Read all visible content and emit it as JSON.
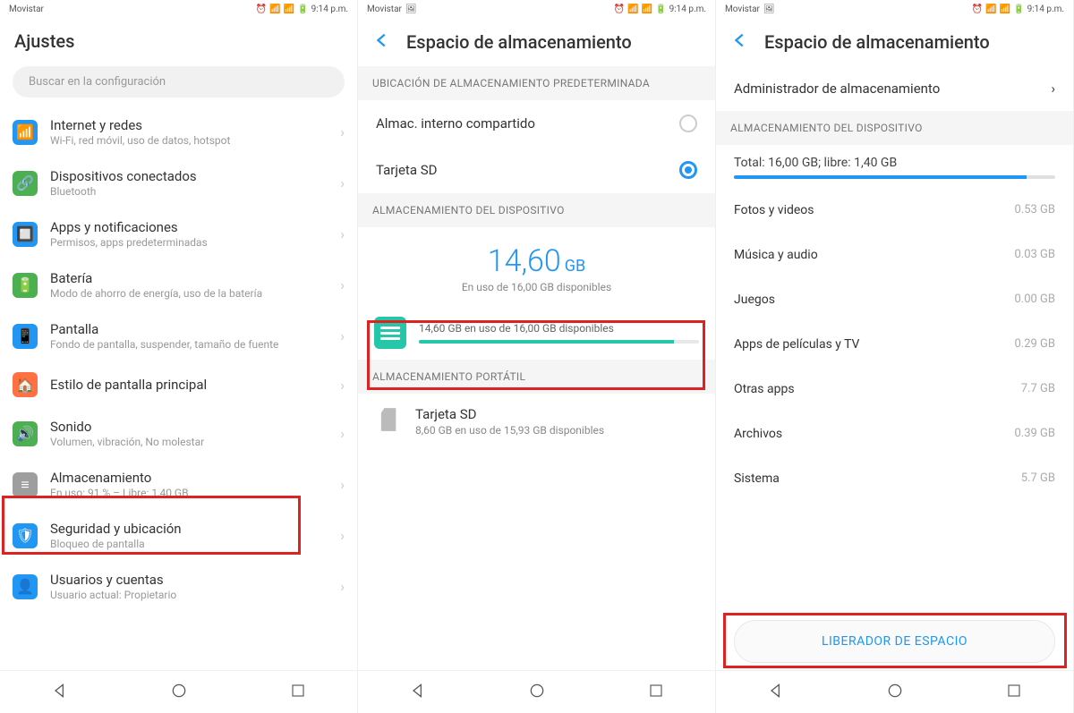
{
  "status": {
    "carrier": "Movistar",
    "time": "9:14 p.m."
  },
  "screen1": {
    "title": "Ajustes",
    "search_placeholder": "Buscar en la configuración",
    "items": [
      {
        "label": "Internet y redes",
        "sub": "Wi-Fi, red móvil, uso de datos, hotspot",
        "color": "#2196F3"
      },
      {
        "label": "Dispositivos conectados",
        "sub": "Bluetooth",
        "color": "#4CAF50"
      },
      {
        "label": "Apps y notificaciones",
        "sub": "Permisos, apps predeterminadas",
        "color": "#2196F3"
      },
      {
        "label": "Batería",
        "sub": "Modo de ahorro de energía, uso de la batería",
        "color": "#4CAF50"
      },
      {
        "label": "Pantalla",
        "sub": "Fondo de pantalla, suspender, tamaño de fuente",
        "color": "#2196F3"
      },
      {
        "label": "Estilo de pantalla principal",
        "sub": "",
        "color": "#FF7043"
      },
      {
        "label": "Sonido",
        "sub": "Volumen, vibración, No molestar",
        "color": "#4CAF50"
      },
      {
        "label": "Almacenamiento",
        "sub": "En uso: 91 % – Libre: 1,40 GB",
        "color": "#9E9E9E"
      },
      {
        "label": "Seguridad y ubicación",
        "sub": "Bloqueo de pantalla",
        "color": "#2196F3"
      },
      {
        "label": "Usuarios y cuentas",
        "sub": "Usuario actual: Propietario",
        "color": "#2196F3"
      }
    ]
  },
  "screen2": {
    "title": "Espacio de almacenamiento",
    "section_default": "UBICACIÓN DE ALMACENAMIENTO PREDETERMINADA",
    "opt_internal": "Almac. interno compartido",
    "opt_sd": "Tarjeta SD",
    "section_device": "ALMACENAMIENTO DEL DISPOSITIVO",
    "used_num": "14,60",
    "used_unit": "GB",
    "used_caption": "En uso de 16,00 GB disponibles",
    "row_text": "14,60 GB en uso de 16,00 GB disponibles",
    "row_pct": 91,
    "section_portable": "ALMACENAMIENTO PORTÁTIL",
    "sd_label": "Tarjeta SD",
    "sd_sub": "8,60 GB en uso de 15,93 GB disponibles"
  },
  "screen3": {
    "title": "Espacio de almacenamiento",
    "admin": "Administrador de almacenamiento",
    "section_device": "ALMACENAMIENTO DEL DISPOSITIVO",
    "total_line": "Total: 16,00 GB; libre: 1,40 GB",
    "total_pct": 91,
    "cats": [
      {
        "label": "Fotos y videos",
        "size": "0.53 GB"
      },
      {
        "label": "Música y audio",
        "size": "0.03 GB"
      },
      {
        "label": "Juegos",
        "size": "0.00 GB"
      },
      {
        "label": "Apps de películas y TV",
        "size": "0.29 GB"
      },
      {
        "label": "Otras apps",
        "size": "7.7 GB"
      },
      {
        "label": "Archivos",
        "size": "0.39 GB"
      },
      {
        "label": "Sistema",
        "size": "5.7 GB"
      }
    ],
    "free_button": "LIBERADOR DE ESPACIO"
  }
}
